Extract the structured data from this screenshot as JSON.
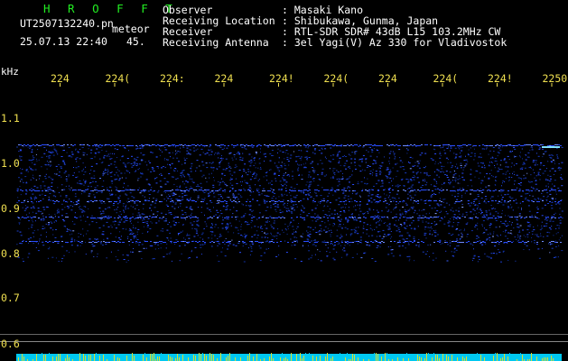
{
  "header": {
    "brand": "H R O F F T",
    "filename": "UT2507132240.pn",
    "tag": "meteor",
    "datetime": "25.07.13 22:40",
    "frame_number": "45.",
    "info": [
      {
        "label": "Observer",
        "value": ": Masaki Kano"
      },
      {
        "label": "Receiving Location",
        "value": ": Shibukawa, Gunma, Japan"
      },
      {
        "label": "Receiver",
        "value": ": RTL-SDR SDR# 43dB L15 103.2MHz CW"
      },
      {
        "label": "Receiving Antenna",
        "value": ": 3el Yagi(V) Az 330 for Vladivostok"
      }
    ]
  },
  "spectrogram": {
    "y_unit": "kHz",
    "y_ticks": [
      "1.1",
      "1.0",
      "0.9",
      "0.8",
      "0.7",
      "0.6"
    ],
    "time_ticks": [
      "224",
      "224(",
      "224:",
      "224",
      "224!",
      "224(",
      "224",
      "224(",
      "224!",
      "2250"
    ],
    "colors": {
      "background": "#000000",
      "signal": "#2a4dff",
      "axis_text": "#f0e050",
      "bottom_band": "#00c8f0",
      "bottom_spikes": "#d8e030"
    }
  }
}
